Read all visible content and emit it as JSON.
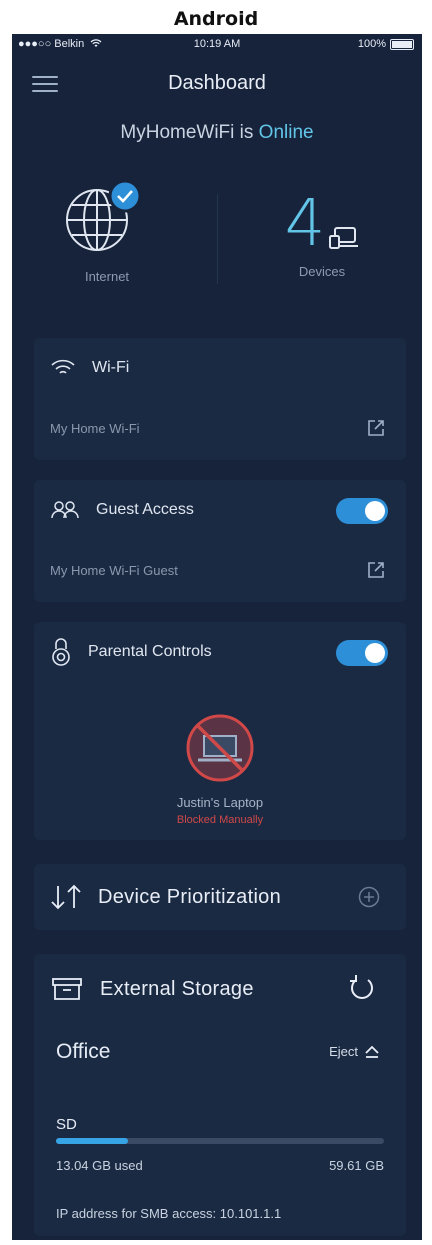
{
  "caption": "Android",
  "statusbar": {
    "carrier": "●●●○○ Belkin",
    "time": "10:19 AM",
    "battery": "100%"
  },
  "header": {
    "title": "Dashboard"
  },
  "network": {
    "name_prefix": "MyHomeWiFi is",
    "status": "Online"
  },
  "summary": {
    "internet_label": "Internet",
    "devices_count": "4",
    "devices_label": "Devices"
  },
  "wifi": {
    "title": "Wi-Fi",
    "network_name": "My Home Wi-Fi"
  },
  "guest": {
    "title": "Guest Access",
    "network_name": "My Home Wi-Fi Guest",
    "enabled": true
  },
  "parental": {
    "title": "Parental Controls",
    "enabled": true,
    "device_name": "Justin's Laptop",
    "device_status": "Blocked Manually"
  },
  "prioritization": {
    "title": "Device Prioritization"
  },
  "storage": {
    "title": "External Storage",
    "drive_name": "Office",
    "eject_label": "Eject",
    "card_label": "SD",
    "used": "13.04 GB used",
    "total": "59.61 GB",
    "used_fraction": 0.22,
    "ip_text": "IP address for SMB access: 10.101.1.1"
  },
  "colors": {
    "background": "#16233a",
    "card": "#1b2a43",
    "accent": "#62c5e8",
    "toggle": "#2d8fd8",
    "blocked": "#d04848"
  }
}
